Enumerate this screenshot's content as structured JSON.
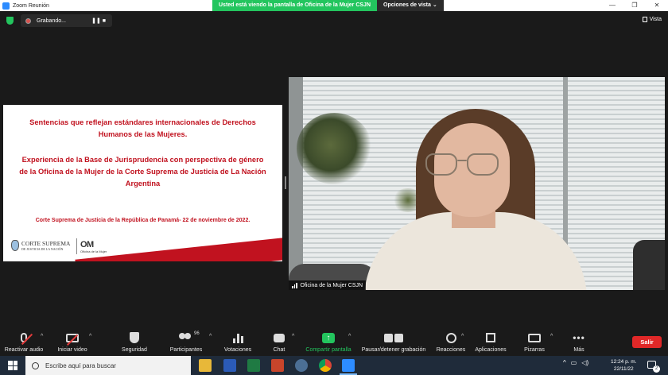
{
  "window": {
    "title": "Zoom Reunión",
    "share_banner": "Usted está viendo la pantalla de Oficina de la Mujer CSJN",
    "view_options": "Opciones de vista",
    "view_options_caret": "⌄",
    "controls": [
      "—",
      "❐",
      "✕"
    ]
  },
  "meeting": {
    "recording_label": "Grabando...",
    "recording_controls": "❚❚  ■",
    "view_button": "Vista"
  },
  "slide": {
    "heading_line1": "Sentencias que reflejan estándares internacionales de Derechos",
    "heading_line2": "Humanos de las Mujeres.",
    "sub_line1": "Experiencia de la Base de Jurisprudencia con perspectiva de género",
    "sub_line2": "de la Oficina de la Mujer de la Corte Suprema de Justicia de La Nación",
    "sub_line3": "Argentina",
    "event_line": "Corte Suprema de Justicia de la República de Panamá- 22 de noviembre de 2022.",
    "logo_corte": "CORTE SUPREMA",
    "logo_corte_sub": "DE JUSTICIA DE LA NACIÓN",
    "logo_om": "OM",
    "logo_om_sub": "Oficina de la Mujer",
    "accent_color": "#c1121f"
  },
  "video": {
    "participant_name": "Oficina de la Mujer CSJN"
  },
  "toolbar": {
    "mute_label": "Reactivar audio",
    "video_label": "Iniciar video",
    "security_label": "Seguridad",
    "participants_label": "Participantes",
    "participants_count": "96",
    "polls_label": "Votaciones",
    "chat_label": "Chat",
    "share_label": "Compartir pantalla",
    "share_glyph": "↑",
    "record_label": "Pausar/detener grabación",
    "reactions_label": "Reacciones",
    "apps_label": "Aplicaciones",
    "whiteboards_label": "Pizarras",
    "more_label": "Más",
    "more_glyph": "•••",
    "leave_label": "Salir",
    "caret": "^",
    "share_color": "#23c55e",
    "leave_color": "#e02828"
  },
  "taskbar": {
    "search_placeholder": "Escribe aquí para buscar",
    "apps": [
      "file-explorer-icon",
      "word-icon",
      "excel-icon",
      "powerpoint-icon",
      "app-icon",
      "chrome-icon",
      "zoom-icon"
    ],
    "tray_caret": "^",
    "tray_network": "▭",
    "tray_volume": "◁)",
    "time": "12:24 p. m.",
    "date": "22/11/22",
    "notifications": "2"
  }
}
